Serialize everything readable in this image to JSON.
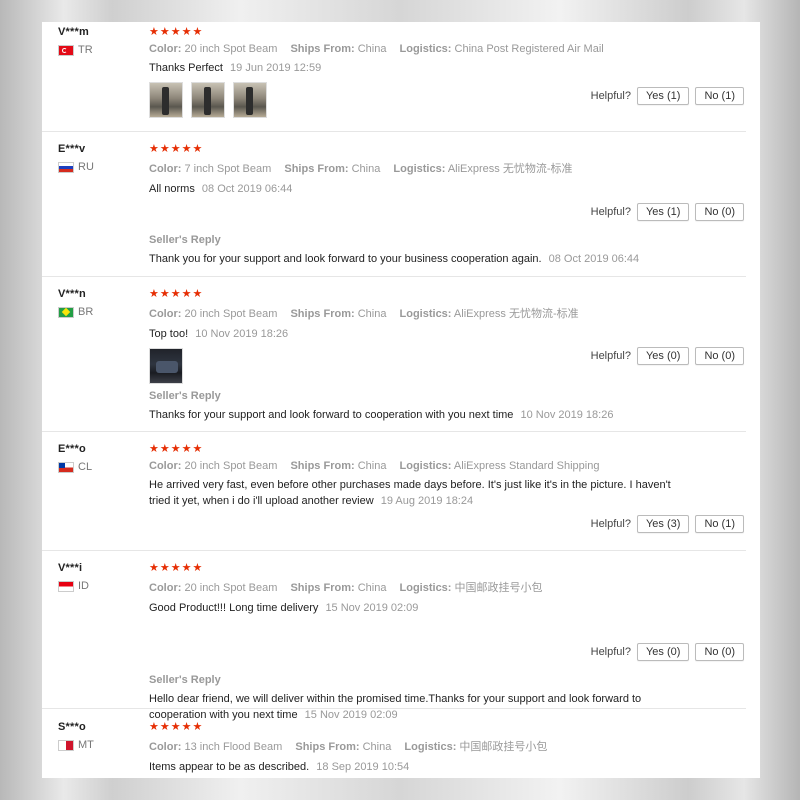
{
  "labels": {
    "color": "Color:",
    "ships_from": "Ships From:",
    "logistics": "Logistics:",
    "helpful": "Helpful?",
    "sellers_reply": "Seller's Reply"
  },
  "reviews": [
    {
      "user": "V***m",
      "country": "TR",
      "flag_icon": "flag-tr-icon",
      "stars": "★★★★★",
      "rating": 5,
      "color": "20 inch Spot Beam",
      "ships_from": "China",
      "logistics": "China Post Registered Air Mail",
      "text": "Thanks Perfect",
      "date": "19 Jun 2019 12:59",
      "photos": 3,
      "yes": "Yes (1)",
      "no": "No (1)"
    },
    {
      "user": "E***v",
      "country": "RU",
      "flag_icon": "flag-ru-icon",
      "stars": "★★★★★",
      "rating": 5,
      "color": "7 inch Spot Beam",
      "ships_from": "China",
      "logistics": "AliExpress 无忧物流-标准",
      "text": "All norms",
      "date": "08 Oct 2019 06:44",
      "yes": "Yes (1)",
      "no": "No (0)",
      "reply": {
        "text": "Thank you for your support and look forward to your business cooperation again.",
        "date": "08 Oct 2019 06:44"
      }
    },
    {
      "user": "V***n",
      "country": "BR",
      "flag_icon": "flag-br-icon",
      "stars": "★★★★★",
      "rating": 5,
      "color": "20 inch Spot Beam",
      "ships_from": "China",
      "logistics": "AliExpress 无忧物流-标准",
      "text": "Top too!",
      "date": "10 Nov 2019 18:26",
      "photos": 1,
      "yes": "Yes (0)",
      "no": "No (0)",
      "reply": {
        "text": "Thanks for your support and look forward to cooperation with you next time",
        "date": "10 Nov 2019 18:26"
      }
    },
    {
      "user": "E***o",
      "country": "CL",
      "flag_icon": "flag-cl-icon",
      "stars": "★★★★★",
      "rating": 5,
      "color": "20 inch Spot Beam",
      "ships_from": "China",
      "logistics": "AliExpress Standard Shipping",
      "text": "He arrived very fast, even before other purchases made days before. It's just like it's in the picture. I haven't tried it yet, when i do i'll upload another review",
      "date": "19 Aug 2019 18:24",
      "yes": "Yes (3)",
      "no": "No (1)"
    },
    {
      "user": "V***i",
      "country": "ID",
      "flag_icon": "flag-id-icon",
      "stars": "★★★★★",
      "rating": 5,
      "color": "20 inch Spot Beam",
      "ships_from": "China",
      "logistics": "中国邮政挂号小包",
      "text": "Good Product!!! Long time delivery",
      "date": "15 Nov 2019 02:09",
      "yes": "Yes (0)",
      "no": "No (0)",
      "reply": {
        "text": "Hello dear friend, we will deliver within the promised time.Thanks for your support and look forward to cooperation with you next time",
        "date": "15 Nov 2019 02:09"
      }
    },
    {
      "user": "S***o",
      "country": "MT",
      "flag_icon": "flag-mt-icon",
      "stars": "★★★★★",
      "rating": 5,
      "color": "13 inch Flood Beam",
      "ships_from": "China",
      "logistics": "中国邮政挂号小包",
      "text": "Items appear to be as described.",
      "date": "18 Sep 2019 10:54"
    }
  ]
}
